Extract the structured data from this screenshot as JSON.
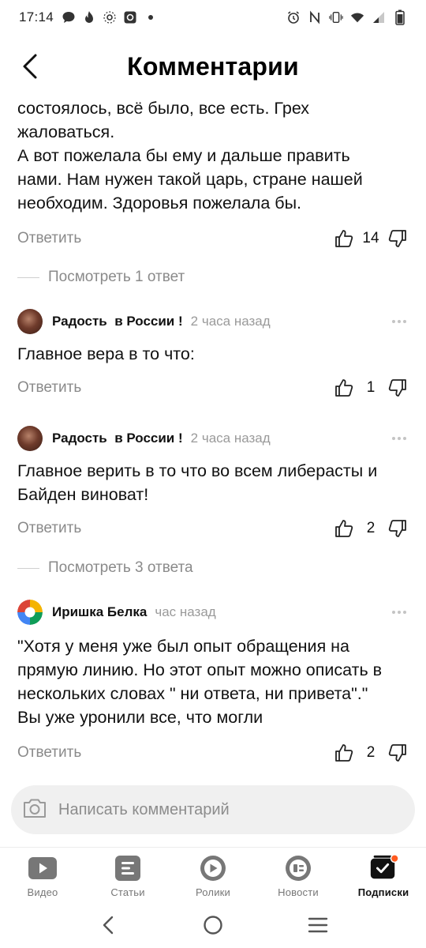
{
  "status_bar": {
    "time": "17:14"
  },
  "header": {
    "title": "Комментарии"
  },
  "comments": [
    {
      "text_lines": [
        "состоялось, всё было, все есть. Грех",
        "жаловаться.",
        "А вот пожелала бы ему и дальше править",
        "нами. Нам нужен такой царь, стране нашей",
        "необходим. Здоровья пожелала бы."
      ],
      "reply_label": "Ответить",
      "likes": "14",
      "view_replies": "Посмотреть 1 ответ"
    },
    {
      "author": "Радость  в России !",
      "time": "2 часа назад",
      "text_lines": [
        "Главное вера в то что:"
      ],
      "reply_label": "Ответить",
      "likes": "1"
    },
    {
      "author": "Радость  в России !",
      "time": "2 часа назад",
      "text_lines": [
        "Главное верить в то что во всем либерасты и",
        "Байден виноват!"
      ],
      "reply_label": "Ответить",
      "likes": "2",
      "view_replies": "Посмотреть 3 ответа"
    },
    {
      "author": "Иришка Белка",
      "time": "час назад",
      "text_lines": [
        "\"Хотя у меня уже был опыт обращения на",
        "прямую линию. Но этот опыт можно описать в",
        "нескольких словах \" ни ответа, ни привета\".\"",
        "Вы уже уронили все, что могли"
      ],
      "reply_label": "Ответить",
      "likes": "2"
    }
  ],
  "composer": {
    "placeholder": "Написать комментарий"
  },
  "tabs": [
    {
      "label": "Видео",
      "icon": "play-icon"
    },
    {
      "label": "Статьи",
      "icon": "article-icon"
    },
    {
      "label": "Ролики",
      "icon": "shorts-icon"
    },
    {
      "label": "Новости",
      "icon": "news-icon"
    },
    {
      "label": "Подписки",
      "icon": "subscriptions-icon",
      "active": true
    }
  ],
  "colors": {
    "accent": "#ff5a1f",
    "muted": "#8a8a8a",
    "icon_gray": "#9a9a9a"
  }
}
